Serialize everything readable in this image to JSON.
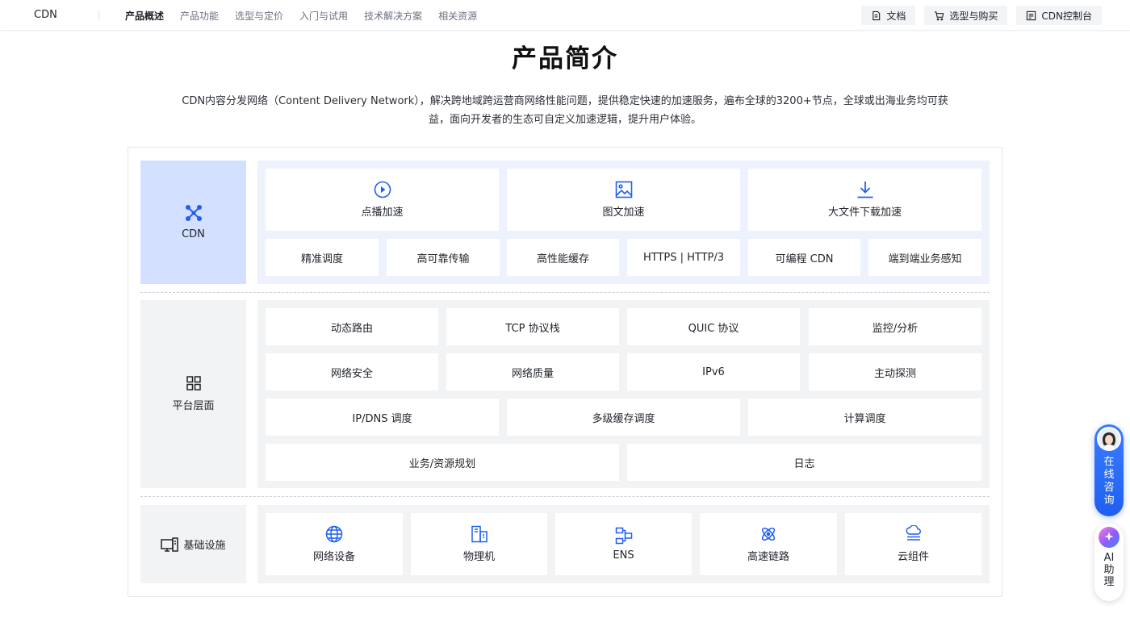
{
  "nav": {
    "brand": "CDN",
    "tabs": [
      "产品概述",
      "产品功能",
      "选型与定价",
      "入门与试用",
      "技术解决方案",
      "相关资源"
    ],
    "actions": {
      "docs": "文档",
      "buy": "选型与购买",
      "console": "CDN控制台"
    }
  },
  "page": {
    "title": "产品简介",
    "intro": "CDN内容分发网络（Content Delivery Network），解决跨地域跨运营商网络性能问题，提供稳定快速的加速服务，遍布全球的3200+节点，全球或出海业务均可获益，面向开发者的生态可自定义加速逻辑，提升用户体验。"
  },
  "architecture": {
    "cdn": {
      "label": "CDN",
      "main": [
        {
          "label": "点播加速",
          "icon": "play-circle-icon"
        },
        {
          "label": "图文加速",
          "icon": "image-icon"
        },
        {
          "label": "大文件下载加速",
          "icon": "download-icon"
        }
      ],
      "features": [
        "精准调度",
        "高可靠传输",
        "高性能缓存",
        "HTTPS | HTTP/3",
        "可编程 CDN",
        "端到端业务感知"
      ]
    },
    "platform": {
      "label": "平台层面",
      "row1": [
        "动态路由",
        "TCP 协议栈",
        "QUIC 协议",
        "监控/分析"
      ],
      "row2": [
        "网络安全",
        "网络质量",
        "IPv6",
        "主动探测"
      ],
      "row3": [
        "IP/DNS 调度",
        "多级缓存调度",
        "计算调度"
      ],
      "row4": [
        "业务/资源规划",
        "日志"
      ]
    },
    "infra": {
      "label": "基础设施",
      "items": [
        {
          "label": "网络设备",
          "icon": "globe-icon"
        },
        {
          "label": "物理机",
          "icon": "server-device-icon"
        },
        {
          "label": "ENS",
          "icon": "edge-network-icon"
        },
        {
          "label": "高速链路",
          "icon": "link-atom-icon"
        },
        {
          "label": "云组件",
          "icon": "cloud-stack-icon"
        }
      ]
    }
  },
  "floating": {
    "consult": "在线咨询",
    "ai": "AI助理"
  },
  "colors": {
    "accent": "#1f5ff0",
    "cdn_label_bg": "#d4e0ff",
    "cdn_panel_bg": "#eef2fd",
    "gray_panel_bg": "#f2f3f5"
  }
}
